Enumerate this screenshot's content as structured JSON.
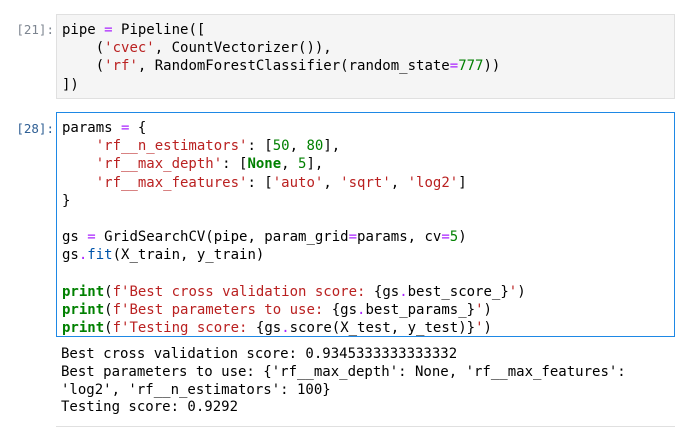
{
  "cells": [
    {
      "prompt": "[21]:",
      "lines": [
        [
          [
            "t",
            "pipe "
          ],
          [
            "op",
            "="
          ],
          [
            "t",
            " Pipeline(["
          ]
        ],
        [
          [
            "t",
            "    ("
          ],
          [
            "str",
            "'cvec'"
          ],
          [
            "t",
            ", CountVectorizer()),"
          ]
        ],
        [
          [
            "t",
            "    ("
          ],
          [
            "str",
            "'rf'"
          ],
          [
            "t",
            ", RandomForestClassifier(random_state"
          ],
          [
            "op",
            "="
          ],
          [
            "num",
            "777"
          ],
          [
            "t",
            "))"
          ]
        ],
        [
          [
            "t",
            "])"
          ]
        ]
      ]
    },
    {
      "prompt": "[28]:",
      "lines": [
        [
          [
            "t",
            "params "
          ],
          [
            "op",
            "="
          ],
          [
            "t",
            " {"
          ]
        ],
        [
          [
            "t",
            "    "
          ],
          [
            "str",
            "'rf__n_estimators'"
          ],
          [
            "t",
            ": ["
          ],
          [
            "num",
            "50"
          ],
          [
            "t",
            ", "
          ],
          [
            "num",
            "80"
          ],
          [
            "t",
            "],"
          ]
        ],
        [
          [
            "t",
            "    "
          ],
          [
            "str",
            "'rf__max_depth'"
          ],
          [
            "t",
            ": ["
          ],
          [
            "kw",
            "None"
          ],
          [
            "t",
            ", "
          ],
          [
            "num",
            "5"
          ],
          [
            "t",
            "],"
          ]
        ],
        [
          [
            "t",
            "    "
          ],
          [
            "str",
            "'rf__max_features'"
          ],
          [
            "t",
            ": ["
          ],
          [
            "str",
            "'auto'"
          ],
          [
            "t",
            ", "
          ],
          [
            "str",
            "'sqrt'"
          ],
          [
            "t",
            ", "
          ],
          [
            "str",
            "'log2'"
          ],
          [
            "t",
            "]"
          ]
        ],
        [
          [
            "t",
            "}"
          ]
        ],
        [
          [
            "t",
            ""
          ]
        ],
        [
          [
            "t",
            "gs "
          ],
          [
            "op",
            "="
          ],
          [
            "t",
            " GridSearchCV(pipe, param_grid"
          ],
          [
            "op",
            "="
          ],
          [
            "t",
            "params, cv"
          ],
          [
            "op",
            "="
          ],
          [
            "num",
            "5"
          ],
          [
            "t",
            ")"
          ]
        ],
        [
          [
            "t",
            "gs"
          ],
          [
            "op",
            "."
          ],
          [
            "fn",
            "fit"
          ],
          [
            "t",
            "(X_train, y_train)"
          ]
        ],
        [
          [
            "t",
            ""
          ]
        ],
        [
          [
            "kw",
            "print"
          ],
          [
            "t",
            "("
          ],
          [
            "str",
            "f'Best cross validation score: "
          ],
          [
            "t",
            "{gs"
          ],
          [
            "op",
            "."
          ],
          [
            "t",
            "best_score_}"
          ],
          [
            "str",
            "'"
          ],
          [
            "t",
            ")"
          ]
        ],
        [
          [
            "kw",
            "print"
          ],
          [
            "t",
            "("
          ],
          [
            "str",
            "f'Best parameters to use: "
          ],
          [
            "t",
            "{gs"
          ],
          [
            "op",
            "."
          ],
          [
            "t",
            "best_params_}"
          ],
          [
            "str",
            "'"
          ],
          [
            "t",
            ")"
          ]
        ],
        [
          [
            "kw",
            "print"
          ],
          [
            "t",
            "("
          ],
          [
            "str",
            "f'Testing score: "
          ],
          [
            "t",
            "{gs"
          ],
          [
            "op",
            "."
          ],
          [
            "t",
            "score(X_test, y_test)}"
          ],
          [
            "str",
            "'"
          ],
          [
            "t",
            ")"
          ]
        ]
      ],
      "output": [
        "Best cross validation score: 0.9345333333333332",
        "Best parameters to use: {'rf__max_depth': None, 'rf__max_features':",
        "'log2', 'rf__n_estimators': 100}",
        "Testing score: 0.9292"
      ]
    }
  ]
}
